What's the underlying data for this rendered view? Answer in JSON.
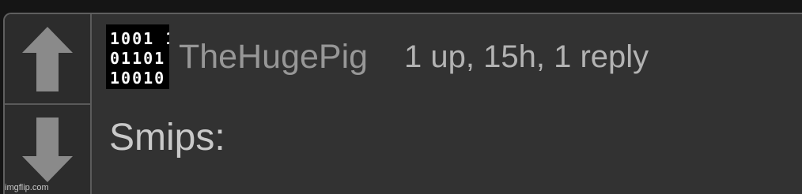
{
  "vote": {
    "up_icon": "up-arrow-icon",
    "down_icon": "down-arrow-icon"
  },
  "comment": {
    "avatar_icon": "binary-avatar-icon",
    "avatar_lines": [
      "1001 1",
      "01101",
      "10010"
    ],
    "username": "TheHugePig",
    "meta": "1 up, 15h, 1 reply",
    "text": "Smips:"
  },
  "watermark": "imgflip.com",
  "colors": {
    "background": "#151515",
    "card": "#323232",
    "border": "#5f5f5f",
    "username": "#979797",
    "meta": "#b3b3b3",
    "text": "#c9c9c9",
    "arrow": "#8a8a8a"
  }
}
